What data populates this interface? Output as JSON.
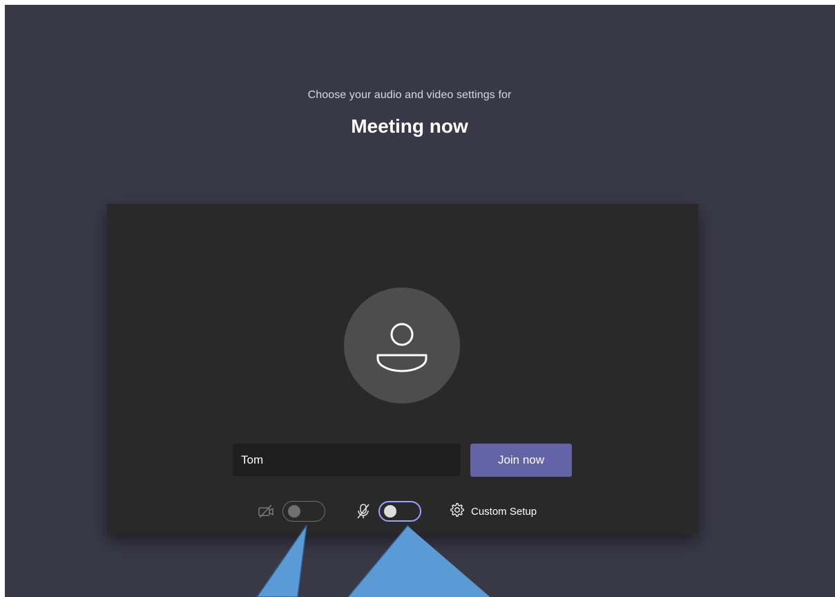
{
  "header": {
    "subtitle": "Choose your audio and video settings for",
    "meeting_title": "Meeting now"
  },
  "prejoin": {
    "name_value": "Tom",
    "join_label": "Join now",
    "custom_setup_label": "Custom Setup"
  },
  "controls": {
    "camera_icon": "camera-off-icon",
    "camera_on": false,
    "mic_icon": "mic-off-icon",
    "mic_on": false,
    "settings_icon": "gear-icon"
  },
  "colors": {
    "background": "#393847",
    "card": "#292929",
    "avatar": "#4d4d4d",
    "join_button": "#6264a7",
    "mic_focus_ring": "#9ea2ff",
    "annotation_fill": "#5b9bd5"
  }
}
